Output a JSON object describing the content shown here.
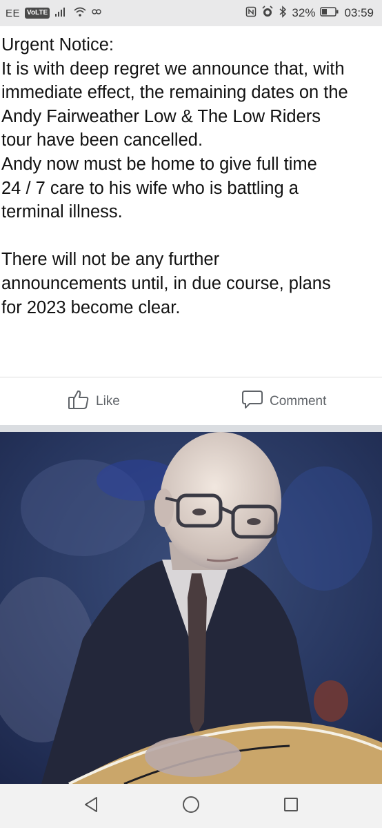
{
  "status_bar": {
    "carrier": "EE",
    "volte": "VoLTE",
    "battery": "32%",
    "time": "03:59"
  },
  "post": {
    "text": "Urgent Notice:\nIt is with deep regret we announce that, with\nimmediate effect, the remaining dates on the\nAndy Fairweather Low & The Low Riders\ntour have been cancelled.\nAndy now must be home to give full time\n24 / 7 care to his wife who is battling a\nterminal illness.\n\nThere will not be any further\nannouncements until, in due course, plans\nfor 2023 become clear."
  },
  "actions": {
    "like_label": "Like",
    "comment_label": "Comment"
  },
  "icons": {
    "signal": "signal-icon",
    "wifi": "wifi-icon",
    "nfc": "nfc-icon",
    "alarm": "alarm-icon",
    "bluetooth": "bluetooth-icon",
    "battery": "battery-icon",
    "like": "thumbs-up-icon",
    "comment": "comment-icon",
    "back": "back-triangle-icon",
    "home": "home-circle-icon",
    "recents": "recents-square-icon"
  },
  "colors": {
    "status_bar_bg": "#e9e9ea",
    "text": "#111111",
    "action_text": "#5f6368",
    "photo_bg": "#2c3e69"
  }
}
